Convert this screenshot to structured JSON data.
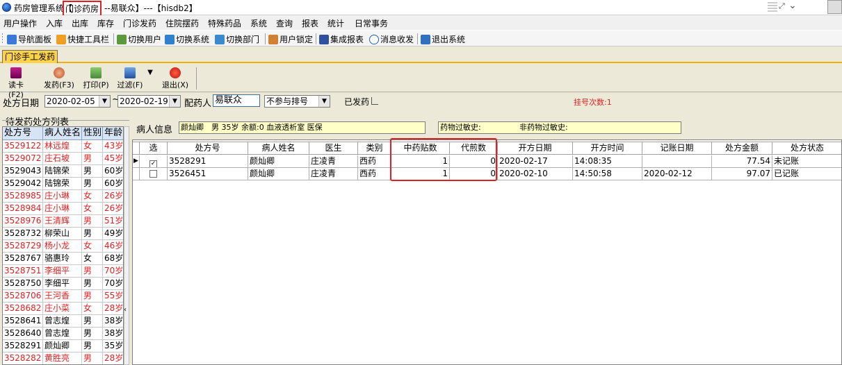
{
  "window": {
    "title_prefix": "药房管理系统【",
    "title_dept": "门诊药房",
    "title_suffix": "--易联众】---【hisdb2】"
  },
  "menu": [
    "用户操作",
    "入库",
    "出库",
    "库存",
    "门诊发药",
    "住院摆药",
    "特殊药品",
    "系统",
    "查询",
    "报表",
    "统计",
    "日常事务"
  ],
  "toolbar": {
    "items": [
      "导航面板",
      "快捷工具栏",
      "切换用户",
      "切换系统",
      "切换部门",
      "用户锁定",
      "集成报表",
      "消息收发",
      "退出系统"
    ]
  },
  "tab": {
    "label": "门诊手工发药"
  },
  "actions": {
    "read_card": "读卡(F2)",
    "dispense": "发药(F3)",
    "print": "打印(P)",
    "filter": "过滤(F)",
    "exit": "退出(X)"
  },
  "filter": {
    "date_label": "处方日期",
    "date_from": "2020-02-05",
    "date_to": "2020-02-19",
    "pharmacist_label": "配药人",
    "pharmacist": "易联众",
    "queue_option": "不参与排号",
    "dispensed_label": "已发药",
    "queue_count_label": "挂号次数:1"
  },
  "pending_list": {
    "title": "待发药处方列表",
    "columns": [
      "处方号",
      "病人姓名",
      "性别",
      "年龄"
    ],
    "rows": [
      {
        "id": "3529122",
        "name": "林远煌",
        "sex": "女",
        "age": "43岁",
        "red": true
      },
      {
        "id": "3529072",
        "name": "庄石坡",
        "sex": "男",
        "age": "45岁",
        "red": true
      },
      {
        "id": "3529043",
        "name": "陆锦荣",
        "sex": "男",
        "age": "60岁",
        "red": false
      },
      {
        "id": "3529042",
        "name": "陆锦荣",
        "sex": "男",
        "age": "60岁",
        "red": false
      },
      {
        "id": "3528985",
        "name": "庄小琳",
        "sex": "女",
        "age": "26岁",
        "red": true
      },
      {
        "id": "3528984",
        "name": "庄小琳",
        "sex": "女",
        "age": "26岁",
        "red": true
      },
      {
        "id": "3528976",
        "name": "王清辉",
        "sex": "男",
        "age": "51岁",
        "red": true
      },
      {
        "id": "3528732",
        "name": "柳荣山",
        "sex": "男",
        "age": "49岁",
        "red": false
      },
      {
        "id": "3528729",
        "name": "杨小龙",
        "sex": "女",
        "age": "46岁",
        "red": true
      },
      {
        "id": "3528767",
        "name": "骆惠玲",
        "sex": "女",
        "age": "68岁",
        "red": false
      },
      {
        "id": "3528751",
        "name": "李细平",
        "sex": "男",
        "age": "70岁",
        "red": true
      },
      {
        "id": "3528750",
        "name": "李细平",
        "sex": "男",
        "age": "70岁",
        "red": false
      },
      {
        "id": "3528706",
        "name": "王河香",
        "sex": "男",
        "age": "55岁",
        "red": true
      },
      {
        "id": "3528682",
        "name": "庄小菜",
        "sex": "女",
        "age": "28岁",
        "red": true
      },
      {
        "id": "3528641",
        "name": "曾志煌",
        "sex": "男",
        "age": "38岁",
        "red": false
      },
      {
        "id": "3528640",
        "name": "曾志煌",
        "sex": "男",
        "age": "38岁",
        "red": false
      },
      {
        "id": "3528291",
        "name": "颜灿卿",
        "sex": "男",
        "age": "35岁",
        "red": false
      },
      {
        "id": "3528282",
        "name": "黄胜亮",
        "sex": "男",
        "age": "28岁",
        "red": true
      }
    ]
  },
  "patient_info": {
    "label": "病人信息",
    "value": "颜灿卿　男 35岁 余额:0 血液透析室 医保",
    "drug_allergy_label": "药物过敏史:",
    "non_drug_allergy_label": "非药物过敏史:"
  },
  "prescriptions": {
    "columns": [
      "选",
      "处方号",
      "病人姓名",
      "医生",
      "类别",
      "中药贴数",
      "代煎数",
      "开方日期",
      "开方时间",
      "记账日期",
      "处方金额",
      "处方状态"
    ],
    "rows": [
      {
        "selected": true,
        "checked": true,
        "id": "3528291",
        "name": "颜灿卿",
        "doctor": "庄凌青",
        "type": "西药",
        "tcm_count": "1",
        "decoction": "0",
        "date": "2020-02-17",
        "time": "14:08:35",
        "bill_date": "",
        "amount": "77.54",
        "status": "未记账"
      },
      {
        "selected": false,
        "checked": false,
        "id": "3526451",
        "name": "颜灿卿",
        "doctor": "庄凌青",
        "type": "西药",
        "tcm_count": "1",
        "decoction": "0",
        "date": "2020-02-10",
        "time": "14:50:58",
        "bill_date": "2020-02-12",
        "amount": "97.07",
        "status": "已记账"
      }
    ]
  },
  "colors": {
    "red_text": "#e02020",
    "highlight": "#e02020",
    "tab": "#ffd24a"
  }
}
